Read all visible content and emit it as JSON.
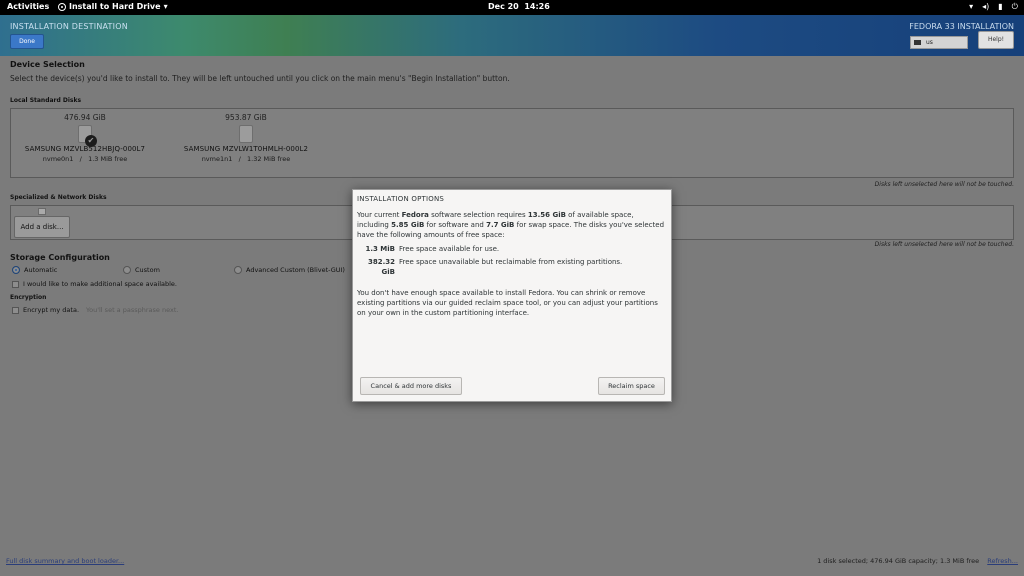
{
  "topbar": {
    "activities": "Activities",
    "app_name": "Install to Hard Drive",
    "app_menu_icon": "chevron-down-icon",
    "date": "Dec 20",
    "time": "14:26",
    "tray_icons": [
      "network-icon",
      "volume-icon",
      "battery-icon",
      "power-icon"
    ]
  },
  "header": {
    "title": "INSTALLATION DESTINATION",
    "done_label": "Done",
    "product": "FEDORA 33 INSTALLATION",
    "keyboard_layout": "us",
    "help_label": "Help!"
  },
  "device_selection": {
    "title": "Device Selection",
    "description": "Select the device(s) you'd like to install to.  They will be left untouched until you click on the main menu's \"Begin Installation\" button.",
    "local_label": "Local Standard Disks",
    "disks": [
      {
        "size": "476.94 GiB",
        "name": "SAMSUNG MZVLB512HBJQ-000L7",
        "device": "nvme0n1",
        "sep": "/",
        "free": "1.3 MiB free",
        "selected": true
      },
      {
        "size": "953.87 GiB",
        "name": "SAMSUNG MZVLW1T0HMLH-000L2",
        "device": "nvme1n1",
        "sep": "/",
        "free": "1.32 MiB free",
        "selected": false
      }
    ],
    "unselected_note": "Disks left unselected here will not be touched.",
    "specialized_label": "Specialized & Network Disks",
    "add_disk_label": "Add a disk...",
    "unselected_note_2": "Disks left unselected here will not be touched."
  },
  "storage_config": {
    "title": "Storage Configuration",
    "options": [
      "Automatic",
      "Custom",
      "Advanced Custom (Blivet-GUI)"
    ],
    "selected": "Automatic",
    "additional_space_label": "I would like to make additional space available.",
    "encryption_title": "Encryption",
    "encrypt_label": "Encrypt my data.",
    "encrypt_hint": "You'll set a passphrase next."
  },
  "footer": {
    "summary_link": "Full disk summary and boot loader...",
    "status": "1 disk selected; 476.94 GiB capacity; 1.3 MiB free",
    "refresh_link": "Refresh..."
  },
  "dialog": {
    "title": "INSTALLATION OPTIONS",
    "para1_a": "Your current ",
    "para1_fedora": "Fedora",
    "para1_b": " software selection requires ",
    "para1_req": "13.56 GiB",
    "para1_c": " of available space, including ",
    "para1_sw": "5.85 GiB",
    "para1_d": " for software and ",
    "para1_swap": "7.7 GiB",
    "para1_e": " for swap space. The disks you've selected have the following amounts of free space:",
    "free_amount": "1.3 MiB",
    "free_label": "Free space available for use.",
    "reclaim_amount": "382.32 GiB",
    "reclaim_label": "Free space unavailable but reclaimable from existing partitions.",
    "para2": "You don't have enough space available to install Fedora.  You can shrink or remove existing partitions via our guided reclaim space tool, or you can adjust your partitions on your own in the custom partitioning interface.",
    "cancel_label": "Cancel & add more disks",
    "reclaim_button": "Reclaim space"
  }
}
